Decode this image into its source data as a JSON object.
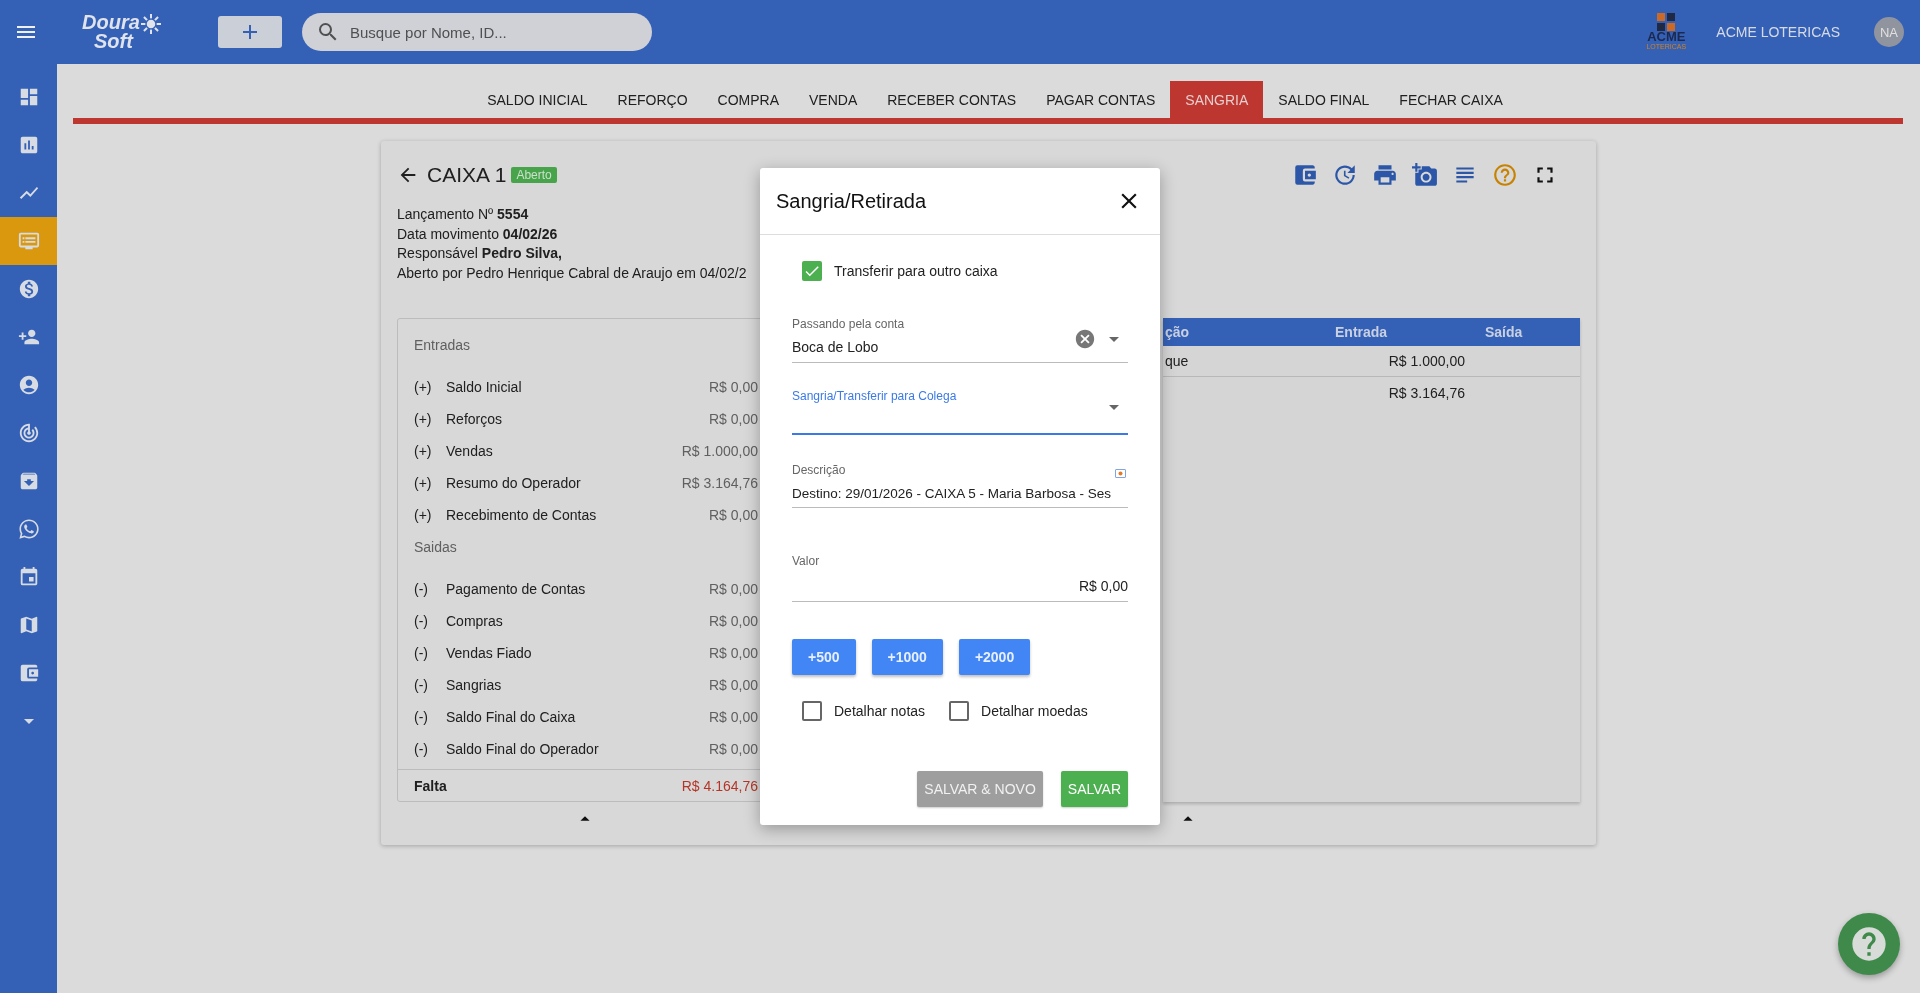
{
  "topbar": {
    "logo": {
      "line1": "Doura",
      "line2": "Soft"
    },
    "search": {
      "placeholder": "Busque por Nome, ID..."
    },
    "company_logo": {
      "name": "ACME",
      "subtitle": "LOTERICAS"
    },
    "company": "ACME LOTERICAS",
    "avatar": "NA"
  },
  "sidebar": {
    "items": [
      {
        "kind": "dashboard",
        "selected": false
      },
      {
        "kind": "bar-chart",
        "selected": false
      },
      {
        "kind": "line-chart",
        "selected": false
      },
      {
        "kind": "monitor",
        "selected": true
      },
      {
        "kind": "dollar",
        "selected": false
      },
      {
        "kind": "person-add",
        "selected": false
      },
      {
        "kind": "account",
        "selected": false
      },
      {
        "kind": "target",
        "selected": false
      },
      {
        "kind": "archive",
        "selected": false
      },
      {
        "kind": "chat",
        "selected": false
      },
      {
        "kind": "calendar",
        "selected": false
      },
      {
        "kind": "map",
        "selected": false
      },
      {
        "kind": "wallet",
        "selected": false
      },
      {
        "kind": "more",
        "selected": false
      }
    ]
  },
  "tabs": [
    {
      "label": "SALDO INICIAL",
      "selected": false
    },
    {
      "label": "REFORÇO",
      "selected": false
    },
    {
      "label": "COMPRA",
      "selected": false
    },
    {
      "label": "VENDA",
      "selected": false
    },
    {
      "label": "RECEBER CONTAS",
      "selected": false
    },
    {
      "label": "PAGAR CONTAS",
      "selected": false
    },
    {
      "label": "SANGRIA",
      "selected": true
    },
    {
      "label": "SALDO FINAL",
      "selected": false
    },
    {
      "label": "FECHAR CAIXA",
      "selected": false
    }
  ],
  "card": {
    "title": "CAIXA 1",
    "status": "Aberto",
    "toolbar": [
      {
        "kind": "wallet"
      },
      {
        "kind": "history"
      },
      {
        "kind": "print"
      },
      {
        "kind": "camera"
      },
      {
        "kind": "notes"
      },
      {
        "kind": "help"
      },
      {
        "kind": "fullscreen"
      }
    ],
    "info": [
      "Lançamento Nº **5554**",
      "Data movimento **04/02/26**",
      "Responsável **Pedro Silva,**",
      "Aberto por Pedro Henrique Cabral de Araujo em 04/02/2"
    ],
    "summary": {
      "sections": [
        {
          "title": "Entradas",
          "rows": [
            {
              "sign": "(+)",
              "label": "Saldo Inicial",
              "value": "R$ 0,00"
            },
            {
              "sign": "(+)",
              "label": "Reforços",
              "value": "R$ 0,00"
            },
            {
              "sign": "(+)",
              "label": "Vendas",
              "value": "R$ 1.000,00"
            },
            {
              "sign": "(+)",
              "label": "Resumo do Operador",
              "value": "R$ 3.164,76"
            },
            {
              "sign": "(+)",
              "label": "Recebimento de Contas",
              "value": "R$ 0,00"
            }
          ]
        },
        {
          "title": "Saidas",
          "rows": [
            {
              "sign": "(-)",
              "label": "Pagamento de Contas",
              "value": "R$ 0,00"
            },
            {
              "sign": "(-)",
              "label": "Compras",
              "value": "R$ 0,00"
            },
            {
              "sign": "(-)",
              "label": "Vendas Fiado",
              "value": "R$ 0,00"
            },
            {
              "sign": "(-)",
              "label": "Sangrias",
              "value": "R$ 0,00"
            },
            {
              "sign": "(-)",
              "label": "Saldo Final do Caixa",
              "value": "R$ 0,00"
            },
            {
              "sign": "(-)",
              "label": "Saldo Final do Operador",
              "value": "R$ 0,00"
            }
          ]
        }
      ],
      "total": {
        "label": "Falta",
        "value": "R$ 4.164,76"
      }
    },
    "table": {
      "columns": {
        "column_1": "ção",
        "entrada": "Entrada",
        "saida": "Saída"
      },
      "rows": [
        {
          "column_1": "que",
          "entrada": "R$ 1.000,00"
        },
        {
          "entrada": "R$ 3.164,76"
        }
      ]
    }
  },
  "dialog": {
    "title": "Sangria/Retirada",
    "transfer": {
      "label": "Transferir para outro caixa",
      "checked": true
    },
    "fields": [
      {
        "kind": "select",
        "label": "Passando pela conta",
        "value": "Boca de Lobo",
        "clearable": true,
        "focused": false
      },
      {
        "kind": "select",
        "label": "Sangria/Transferir para Colega",
        "focused": true
      },
      {
        "kind": "text",
        "label": "Descrição",
        "value": "Destino: 29/01/2026 - CAIXA 5 - Maria Barbosa - Ses",
        "focused": false
      },
      {
        "kind": "currency",
        "label": "Valor",
        "value": "R$ 0,00",
        "focused": false
      }
    ],
    "quick_buttons": [
      "+500",
      "+1000",
      "+2000"
    ],
    "options": [
      {
        "label": "Detalhar notas",
        "checked": false
      },
      {
        "label": "Detalhar moedas",
        "checked": false
      }
    ],
    "actions": [
      {
        "label": "SALVAR & NOVO",
        "kind": "secondary"
      },
      {
        "label": "SALVAR",
        "kind": "primary"
      }
    ]
  }
}
